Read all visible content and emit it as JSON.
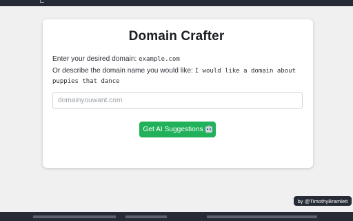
{
  "app": {
    "title": "Domain Crafter"
  },
  "instructions": {
    "line1_prefix": "Enter your desired domain: ",
    "line1_example": "example.com",
    "line2_prefix": "Or describe the domain name you would like: ",
    "line2_example_part1": "I would like a domain about",
    "line2_example_part2": "puppies that dance"
  },
  "form": {
    "input_placeholder": "domainyouwant.com",
    "input_value": "",
    "submit_label": "Get AI Suggestions"
  },
  "credit": {
    "label": "by @TimothyBramlett"
  },
  "colors": {
    "accent": "#21b15a",
    "dark_bar": "#262b35",
    "background": "#f0f0f1"
  },
  "icons": {
    "submit_icon": "robot-icon"
  }
}
